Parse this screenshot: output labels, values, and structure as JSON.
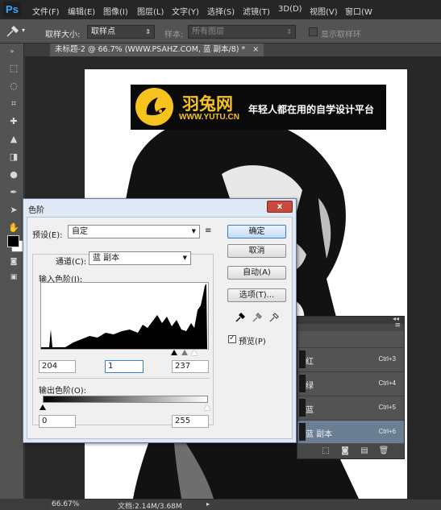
{
  "app": {
    "logo": "Ps"
  },
  "menu": [
    "文件(F)",
    "编辑(E)",
    "图像(I)",
    "图层(L)",
    "文字(Y)",
    "选择(S)",
    "滤镜(T)",
    "3D(D)",
    "视图(V)",
    "窗口(W"
  ],
  "options_bar": {
    "tool_icon": "eyedropper-icon",
    "sample_size_label": "取样大小:",
    "sample_size_value": "取样点",
    "sample_label": "样本:",
    "sample_value": "所有图层",
    "show_ring_label": "显示取样环"
  },
  "document_tab": {
    "title": "未标题-2 @ 66.7% (WWW.PSAHZ.COM, 蓝 副本/8) *",
    "close": "×"
  },
  "banner": {
    "brand": "羽兔网",
    "url": "WWW.YUTU.CN",
    "tagline": "年轻人都在用的自学设计平台"
  },
  "channels_panel": {
    "channels": [
      {
        "name": "红",
        "shortcut": "Ctrl+3",
        "selected": false
      },
      {
        "name": "绿",
        "shortcut": "Ctrl+4",
        "selected": false
      },
      {
        "name": "蓝",
        "shortcut": "Ctrl+5",
        "selected": false
      },
      {
        "name": "蓝 副本",
        "shortcut": "Ctrl+6",
        "selected": true
      }
    ]
  },
  "status_bar": {
    "zoom": "66.67%",
    "doc_size": "文档:2.14M/3.68M"
  },
  "levels_dialog": {
    "title": "色阶",
    "close": "x",
    "preset_label": "预设(E):",
    "preset_value": "自定",
    "channel_label": "通道(C):",
    "channel_value": "蓝 副本",
    "input_label": "输入色阶(I):",
    "output_label": "输出色阶(O):",
    "input_values": {
      "black": "204",
      "gamma": "1",
      "white": "237"
    },
    "output_values": {
      "black": "0",
      "white": "255"
    },
    "buttons": {
      "ok": "确定",
      "cancel": "取消",
      "auto": "自动(A)",
      "options": "选项(T)..."
    },
    "preview_label": "预览(P)",
    "preview_checked": true
  }
}
